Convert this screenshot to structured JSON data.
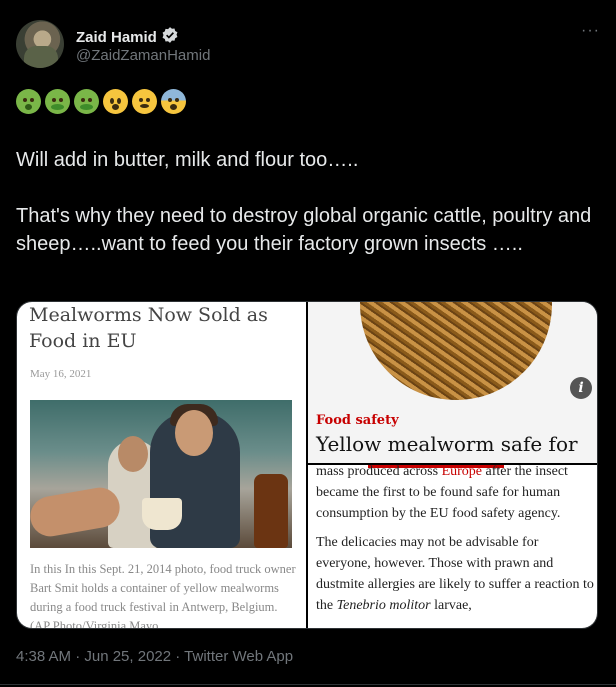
{
  "author": {
    "name": "Zaid Hamid",
    "handle": "@ZaidZamanHamid",
    "verified_icon": "verified-badge-icon"
  },
  "more_label": "···",
  "emojis": [
    {
      "name": "nauseated-face-icon",
      "color": "#7ab648"
    },
    {
      "name": "vomiting-face-icon",
      "color": "#7ab648"
    },
    {
      "name": "vomiting-face-icon",
      "color": "#7ab648"
    },
    {
      "name": "astonished-face-icon",
      "color": "#f6c53e"
    },
    {
      "name": "worried-face-icon",
      "color": "#f6c53e"
    },
    {
      "name": "anxious-face-icon",
      "color": "#9fc5e2"
    }
  ],
  "tweet_text": "Will add in butter, milk and flour too…..\n\nThat's why they need to destroy global organic cattle, poultry and sheep…..want to feed you their factory grown insects …..",
  "media": {
    "left": {
      "title": "Mealworms Now Sold as Food in EU",
      "date": "May 16, 2021",
      "caption": "In this In this Sept. 21, 2014 photo, food truck owner Bart Smit holds a container of yellow mealworms during a food truck festival in Antwerp, Belgium. (AP Photo/Virginia Mayo,"
    },
    "right_top": {
      "info_label": "i",
      "category": "Food safety",
      "headline": "Yellow mealworm safe for"
    },
    "right_bottom": {
      "line1_pre": "mass produced across ",
      "line1_link": "Europe",
      "line1_post": " after the insect became the first to be found safe for human consumption by the EU food safety agency.",
      "para2_pre": "The delicacies may not be advisable for everyone, however. Those with prawn and dustmite allergies are likely to suffer a reaction to the ",
      "para2_italic": "Tenebrio molitor",
      "para2_post": " larvae,"
    }
  },
  "footer": "4:38 AM · Jun 25, 2022 · Twitter Web App",
  "colors": {
    "background": "#000000",
    "text": "#e7e9ea",
    "muted": "#71767b",
    "guardian_red": "#c70000"
  }
}
